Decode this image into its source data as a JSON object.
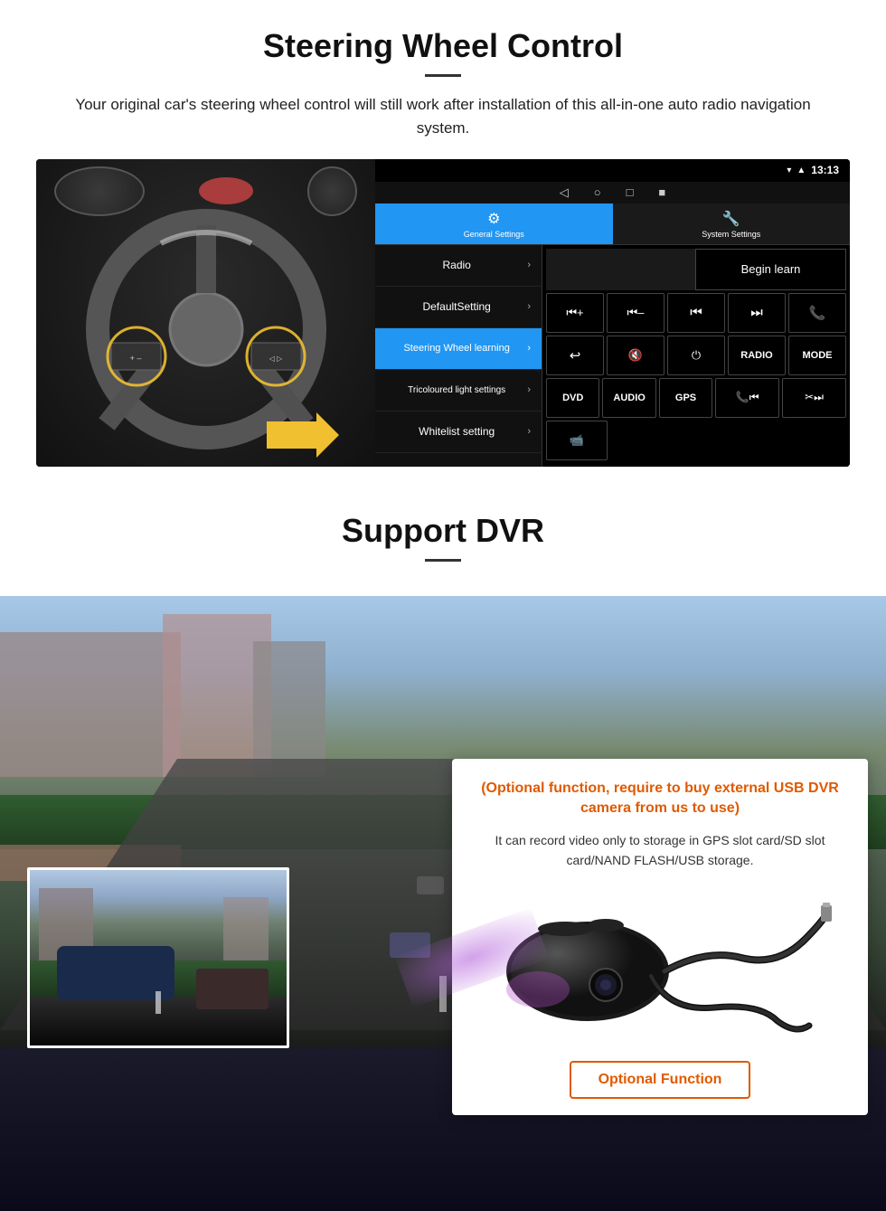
{
  "page": {
    "section1": {
      "title": "Steering Wheel Control",
      "description": "Your original car's steering wheel control will still work after installation of this all-in-one auto radio navigation system."
    },
    "section2": {
      "title": "Support DVR",
      "optional_header": "(Optional function, require to buy external USB DVR camera from us to use)",
      "description": "It can record video only to storage in GPS slot card/SD slot card/NAND FLASH/USB storage.",
      "optional_button": "Optional Function"
    }
  },
  "android_ui": {
    "status_time": "13:13",
    "tabs": [
      {
        "label": "General Settings",
        "active": true
      },
      {
        "label": "System Settings",
        "active": false
      }
    ],
    "menu_items": [
      {
        "label": "Radio",
        "active": false
      },
      {
        "label": "DefaultSetting",
        "active": false
      },
      {
        "label": "Steering Wheel learning",
        "active": true
      },
      {
        "label": "Tricoloured light settings",
        "active": false
      },
      {
        "label": "Whitelist setting",
        "active": false
      }
    ],
    "begin_learn": "Begin learn",
    "control_buttons": {
      "row1": [
        "⏮+",
        "⏮–",
        "⏮⏮",
        "⏭⏭",
        "📞"
      ],
      "row2": [
        "↩",
        "🔇",
        "⏻",
        "RADIO",
        "MODE"
      ],
      "row3": [
        "DVD",
        "AUDIO",
        "GPS",
        "📞⏮",
        "✂⏭"
      ],
      "row4": [
        "📹"
      ]
    }
  }
}
